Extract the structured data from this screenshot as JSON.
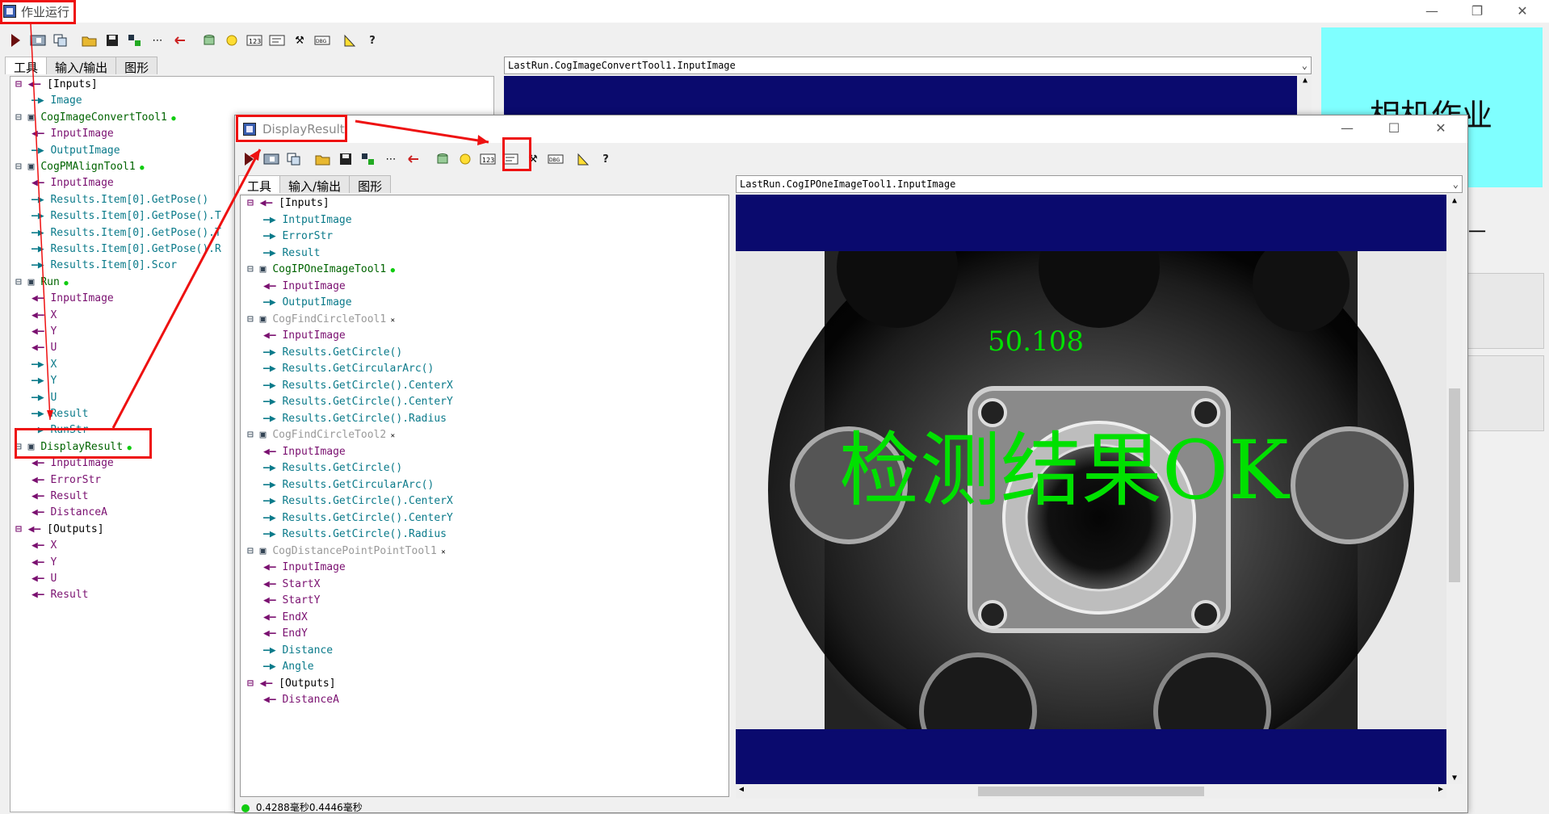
{
  "main_window": {
    "title": "作业运行",
    "controls": {
      "minimize": "—",
      "restore": "❐",
      "close": "✕"
    },
    "tabs": [
      "工具",
      "输入/输出",
      "图形"
    ],
    "display_combo": "LastRun.CogImageConvertTool1.InputImage",
    "side_label": "相机作业",
    "side_cut_char": "一",
    "tree": [
      {
        "label": "[Inputs]",
        "kind": "group"
      },
      {
        "label": "Image",
        "kind": "out"
      },
      {
        "label": "CogImageConvertTool1",
        "kind": "tool"
      },
      {
        "label": "InputImage",
        "kind": "in"
      },
      {
        "label": "OutputImage",
        "kind": "out"
      },
      {
        "label": "CogPMAlignTool1",
        "kind": "tool"
      },
      {
        "label": "InputImage",
        "kind": "in"
      },
      {
        "label": "Results.Item[0].GetPose()",
        "kind": "out"
      },
      {
        "label": "Results.Item[0].GetPose().T",
        "kind": "out"
      },
      {
        "label": "Results.Item[0].GetPose().T",
        "kind": "out"
      },
      {
        "label": "Results.Item[0].GetPose().R",
        "kind": "out"
      },
      {
        "label": "Results.Item[0].Scor",
        "kind": "out"
      },
      {
        "label": "Run",
        "kind": "tool"
      },
      {
        "label": "InputImage",
        "kind": "in"
      },
      {
        "label": "X",
        "kind": "in"
      },
      {
        "label": "Y",
        "kind": "in"
      },
      {
        "label": "U",
        "kind": "in"
      },
      {
        "label": "X",
        "kind": "out"
      },
      {
        "label": "Y",
        "kind": "out"
      },
      {
        "label": "U",
        "kind": "out"
      },
      {
        "label": "Result",
        "kind": "out"
      },
      {
        "label": "RunStr",
        "kind": "out"
      },
      {
        "label": "DisplayResult",
        "kind": "tool"
      },
      {
        "label": "InputImage",
        "kind": "in"
      },
      {
        "label": "ErrorStr",
        "kind": "in"
      },
      {
        "label": "Result",
        "kind": "in"
      },
      {
        "label": "DistanceA",
        "kind": "in"
      },
      {
        "label": "[Outputs]",
        "kind": "group"
      },
      {
        "label": "X",
        "kind": "in"
      },
      {
        "label": "Y",
        "kind": "in"
      },
      {
        "label": "U",
        "kind": "in"
      },
      {
        "label": "Result",
        "kind": "in"
      }
    ]
  },
  "display_window": {
    "title": "DisplayResult",
    "controls": {
      "minimize": "—",
      "restore": "☐",
      "close": "✕"
    },
    "tabs": [
      "工具",
      "输入/输出",
      "图形"
    ],
    "display_combo": "LastRun.CogIPOneImageTool1.InputImage",
    "status_text": "0.4288毫秒0.4446毫秒",
    "overlay_value": "50.108",
    "overlay_result": "检测结果OK",
    "tree": [
      {
        "label": "[Inputs]",
        "kind": "group"
      },
      {
        "label": "IntputImage",
        "kind": "out"
      },
      {
        "label": "ErrorStr",
        "kind": "out"
      },
      {
        "label": "Result",
        "kind": "out"
      },
      {
        "label": "CogIPOneImageTool1",
        "kind": "tool"
      },
      {
        "label": "InputImage",
        "kind": "in"
      },
      {
        "label": "OutputImage",
        "kind": "out"
      },
      {
        "label": "CogFindCircleTool1",
        "kind": "tool-dim"
      },
      {
        "label": "InputImage",
        "kind": "in"
      },
      {
        "label": "Results.GetCircle()",
        "kind": "out"
      },
      {
        "label": "Results.GetCircularArc()",
        "kind": "out"
      },
      {
        "label": "Results.GetCircle().CenterX",
        "kind": "out"
      },
      {
        "label": "Results.GetCircle().CenterY",
        "kind": "out"
      },
      {
        "label": "Results.GetCircle().Radius",
        "kind": "out"
      },
      {
        "label": "CogFindCircleTool2",
        "kind": "tool-dim"
      },
      {
        "label": "InputImage",
        "kind": "in"
      },
      {
        "label": "Results.GetCircle()",
        "kind": "out"
      },
      {
        "label": "Results.GetCircularArc()",
        "kind": "out"
      },
      {
        "label": "Results.GetCircle().CenterX",
        "kind": "out"
      },
      {
        "label": "Results.GetCircle().CenterY",
        "kind": "out"
      },
      {
        "label": "Results.GetCircle().Radius",
        "kind": "out"
      },
      {
        "label": "CogDistancePointPointTool1",
        "kind": "tool-dim"
      },
      {
        "label": "InputImage",
        "kind": "in"
      },
      {
        "label": "StartX",
        "kind": "in"
      },
      {
        "label": "StartY",
        "kind": "in"
      },
      {
        "label": "EndX",
        "kind": "in"
      },
      {
        "label": "EndY",
        "kind": "in"
      },
      {
        "label": "Distance",
        "kind": "out"
      },
      {
        "label": "Angle",
        "kind": "out"
      },
      {
        "label": "[Outputs]",
        "kind": "group"
      },
      {
        "label": "DistanceA",
        "kind": "in"
      }
    ]
  },
  "colors": {
    "accent_red": "#e11111",
    "overlay_green": "#00e000",
    "image_bg": "#0a0a6e",
    "side_cyan": "#7fffff"
  }
}
